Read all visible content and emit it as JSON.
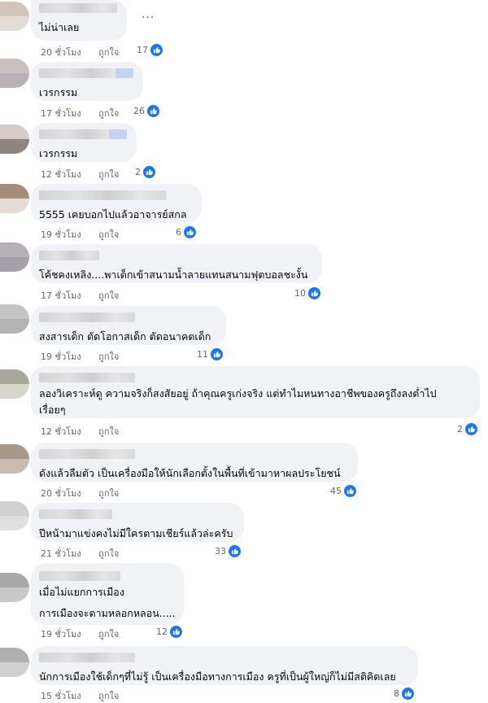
{
  "comments": [
    {
      "text": [
        "ไม่น่าเลย"
      ],
      "time": "20 ชั่วโมง",
      "like_label": "ถูกใจ",
      "reactions": "17"
    },
    {
      "text": [
        "เวรกรรม"
      ],
      "time": "17 ชั่วโมง",
      "like_label": "ถูกใจ",
      "reactions": "26"
    },
    {
      "text": [
        "เวรกรรม"
      ],
      "time": "12 ชั่วโมง",
      "like_label": "ถูกใจ",
      "reactions": "2"
    },
    {
      "text": [
        "5555 เคยบอกไปแล้วอาจารย์สกล"
      ],
      "time": "19 ชั่วโมง",
      "like_label": "ถูกใจ",
      "reactions": "6"
    },
    {
      "text": [
        "โค้ชคงเหลิง....พาเด็กเข้าสนามน้ำลายแทนสนามฟุตบอลชะงั้น"
      ],
      "time": "17 ชั่วโมง",
      "like_label": "ถูกใจ",
      "reactions": "10"
    },
    {
      "text": [
        "สงสารเด็ก ตัดโอกาสเด็ก ตัดอนาคตเด็ก"
      ],
      "time": "19 ชั่วโมง",
      "like_label": "ถูกใจ",
      "reactions": "11"
    },
    {
      "text": [
        "ลองวิเคราะห์ดู ความจริงก็สงสัยอยู่ ถ้าคุณครูเก่งจริง แต่ทำไมหนทางอาชีพของครูถึงลงต่ำไป",
        "เรื่อยๆ"
      ],
      "time": "12 ชั่วโมง",
      "like_label": "ถูกใจ",
      "reactions": "2"
    },
    {
      "text": [
        "ดังแล้วลืมตัว เป็นเครื่องมือให้นักเลือกตั้งในพื้นที่เข้ามาหาผลประโยชน์"
      ],
      "time": "20 ชั่วโมง",
      "like_label": "ถูกใจ",
      "reactions": "45"
    },
    {
      "text": [
        "ปีหน้ามาแข่งคงไม่มีใครตามเชียร์แล้วล่ะครับ"
      ],
      "time": "21 ชั่วโมง",
      "like_label": "ถูกใจ",
      "reactions": "33"
    },
    {
      "text": [
        "เมื่อไม่แยกการเมือง",
        "การเมืองจะตามหลอกหลอน....."
      ],
      "time": "19 ชั่วโมง",
      "like_label": "ถูกใจ",
      "reactions": "12"
    },
    {
      "text": [
        "นักการเมืองใช้เด็กๆที่ไม่รู้ เป็นเครื่องมือทางการเมือง ครูที่เป็นผู้ใหญ่ก็ไม่มีสติคิดเลย"
      ],
      "time": "15 ชั่วโมง",
      "like_label": "ถูกใจ",
      "reactions": "8"
    }
  ],
  "more_label": "...",
  "colors": {
    "bubble": "#f0f2f5",
    "meta": "#65676b",
    "like": "#1877f2"
  }
}
